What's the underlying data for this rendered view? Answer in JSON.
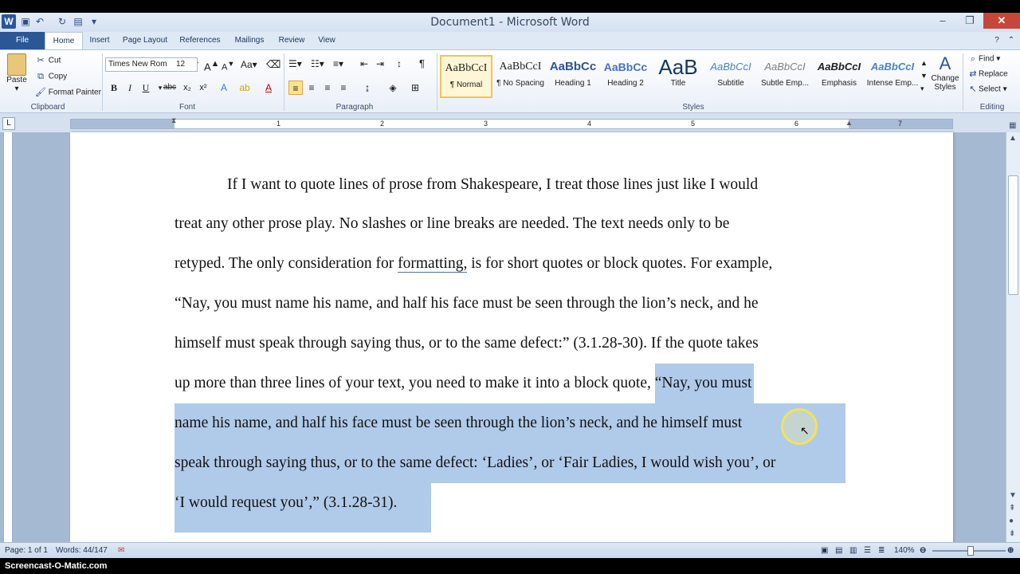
{
  "window": {
    "title": "Document1 - Microsoft Word"
  },
  "tabs": [
    "File",
    "Home",
    "Insert",
    "Page Layout",
    "References",
    "Mailings",
    "Review",
    "View"
  ],
  "clipboard": {
    "paste": "Paste",
    "cut": "Cut",
    "copy": "Copy",
    "format_painter": "Format Painter",
    "label": "Clipboard"
  },
  "font": {
    "name": "Times New Rom",
    "size": "12",
    "label": "Font"
  },
  "paragraph": {
    "label": "Paragraph"
  },
  "styles": {
    "label": "Styles",
    "items": [
      {
        "sample": "AaBbCcI",
        "name": "¶ Normal"
      },
      {
        "sample": "AaBbCcI",
        "name": "¶ No Spacing"
      },
      {
        "sample": "AaBbCc",
        "name": "Heading 1"
      },
      {
        "sample": "AaBbCc",
        "name": "Heading 2"
      },
      {
        "sample": "AaB",
        "name": "Title"
      },
      {
        "sample": "AaBbCcI",
        "name": "Subtitle"
      },
      {
        "sample": "AaBbCcI",
        "name": "Subtle Emp..."
      },
      {
        "sample": "AaBbCcI",
        "name": "Emphasis"
      },
      {
        "sample": "AaBbCcI",
        "name": "Intense Emp..."
      }
    ],
    "change_styles": "Change Styles"
  },
  "editing": {
    "find": "Find",
    "replace": "Replace",
    "select": "Select",
    "label": "Editing"
  },
  "ruler": {
    "numbers": [
      "1",
      "2",
      "3",
      "4",
      "5",
      "6",
      "7"
    ]
  },
  "document": {
    "lines": [
      {
        "plain": "If I want to quote lines of prose from Shakespeare, I treat those lines just like I would"
      },
      {
        "plain": "treat any other prose play.  No slashes or line breaks are needed.  The text needs only to be"
      },
      {
        "before": "retyped.  The only consideration for ",
        "underlined": "formatting,",
        "after": " is for short quotes or block quotes.  For example,"
      },
      {
        "plain": "“Nay, you must name his name, and half his face must be seen through the lion’s neck, and he"
      },
      {
        "plain": "himself must speak through saying thus, or to the same defect:” (3.1.28-30).  If the quote takes"
      },
      {
        "before": "up more than three lines of your text, you need to make it into a block quote, ",
        "selected": "“Nay, you must"
      },
      {
        "selected": "name his name, and half his face must be seen through the lion’s neck, and he himself must"
      },
      {
        "selected": "speak through saying thus, or to the same defect:  ‘Ladies’, or ‘Fair Ladies, I would wish you’, or"
      },
      {
        "selected": "‘I would request you’,” (3.1.28-31)."
      }
    ]
  },
  "status": {
    "page": "Page: 1 of 1",
    "words": "Words: 44/147",
    "zoom": "140%"
  },
  "zoom_fraction": 0.5,
  "watermark": "Screencast-O-Matic.com"
}
